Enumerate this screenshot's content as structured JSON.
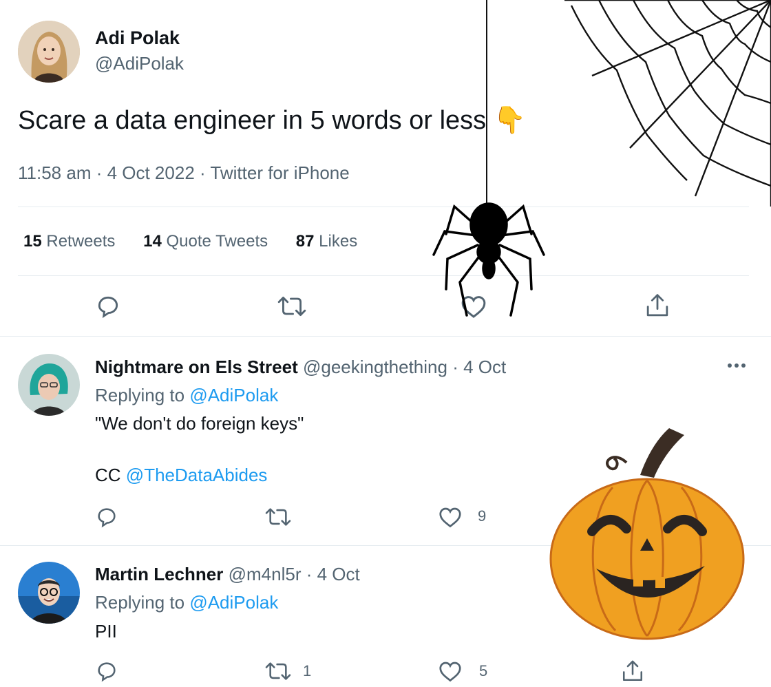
{
  "main_tweet": {
    "author_name": "Adi Polak",
    "author_handle": "@AdiPolak",
    "text": "Scare a data engineer in 5 words or less",
    "emoji": "👇",
    "meta": "11:58 am · 4 Oct 2022 · Twitter for iPhone",
    "stats": [
      {
        "count": "15",
        "label": "Retweets"
      },
      {
        "count": "14",
        "label": "Quote Tweets"
      },
      {
        "count": "87",
        "label": "Likes"
      }
    ]
  },
  "replies": [
    {
      "author_name": "Nightmare on Els Street",
      "author_handle": "@geekingthething",
      "date": "· 4 Oct",
      "replying_prefix": "Replying to",
      "replying_to": "@AdiPolak",
      "text_line1": "\"We don't do foreign keys\"",
      "text_line2_prefix": "CC",
      "text_line2_mention": "@TheDataAbides",
      "like_count": "9"
    },
    {
      "author_name": "Martin Lechner",
      "author_handle": "@m4nl5r",
      "date": "· 4 Oct",
      "replying_prefix": "Replying to",
      "replying_to": "@AdiPolak",
      "text_line1": "PII",
      "retweet_count": "1",
      "like_count": "5"
    }
  ],
  "colors": {
    "text": "#0f1419",
    "muted": "#536471",
    "link": "#1d9bf0",
    "divider": "#e6ecf0",
    "pumpkin": "#f0a021"
  },
  "icons": [
    "reply-icon",
    "retweet-icon",
    "like-icon",
    "share-icon",
    "more-icon",
    "spider-web",
    "spider",
    "pumpkin"
  ]
}
